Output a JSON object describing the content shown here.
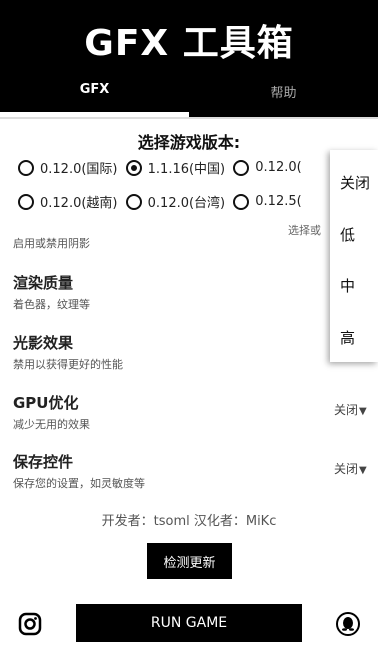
{
  "app": {
    "title": "GFX 工具箱"
  },
  "tabs": [
    {
      "label": "GFX"
    },
    {
      "label": "帮助"
    }
  ],
  "version_section": {
    "title": "选择游戏版本:",
    "options_row1": [
      {
        "label": "0.12.0(国际)",
        "checked": false
      },
      {
        "label": "1.1.16(中国)",
        "checked": true
      },
      {
        "label": "0.12.0(",
        "checked": false
      }
    ],
    "options_row2": [
      {
        "label": "0.12.0(越南)",
        "checked": false
      },
      {
        "label": "0.12.0(台湾)",
        "checked": false
      },
      {
        "label": "0.12.5(",
        "checked": false
      }
    ]
  },
  "settings": {
    "shadow": {
      "desc": "启用或禁用阴影",
      "value_partial": "选择或"
    },
    "render_quality": {
      "title": "渲染质量",
      "desc": "着色器，纹理等"
    },
    "light_effects": {
      "title": "光影效果",
      "desc": "禁用以获得更好的性能"
    },
    "gpu_opt": {
      "title": "GPU优化",
      "desc": "减少无用的效果",
      "value": "关闭"
    },
    "save_controls": {
      "title": "保存控件",
      "desc": "保存您的设置，如灵敏度等",
      "value": "关闭"
    }
  },
  "popup_menu": {
    "items": [
      "关闭",
      "低",
      "中",
      "高"
    ]
  },
  "footer": {
    "credits": "开发者：tsoml   汉化者：MiKc",
    "check_update": "检测更新",
    "run_game": "RUN GAME"
  },
  "icons": {
    "left": "instagram-icon",
    "right": "qq-penguin-icon",
    "dropdown": "triangle-down-icon"
  }
}
